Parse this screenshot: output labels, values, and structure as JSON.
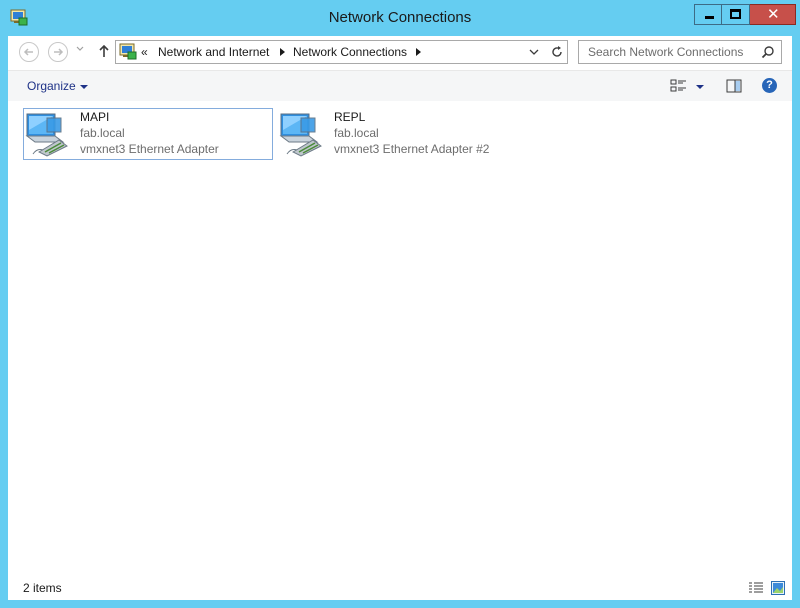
{
  "window": {
    "title": "Network Connections",
    "close_glyph": "✕"
  },
  "address": {
    "overflow": "«",
    "crumbs": [
      "Network and Internet",
      "Network Connections"
    ]
  },
  "search": {
    "placeholder": "Search Network Connections"
  },
  "toolbar": {
    "organize_label": "Organize",
    "help_glyph": "?"
  },
  "connections": [
    {
      "name": "MAPI",
      "domain": "fab.local",
      "device": "vmxnet3 Ethernet Adapter",
      "selected": true
    },
    {
      "name": "REPL",
      "domain": "fab.local",
      "device": "vmxnet3 Ethernet Adapter #2",
      "selected": false
    }
  ],
  "status": {
    "item_count": "2 items"
  },
  "icons": {
    "app": "network-connections-icon",
    "adapter": "network-adapter-icon"
  },
  "colors": {
    "frame": "#65cdf1",
    "close": "#c7504a",
    "link": "#1e3287",
    "selection_border": "#84acdd"
  }
}
